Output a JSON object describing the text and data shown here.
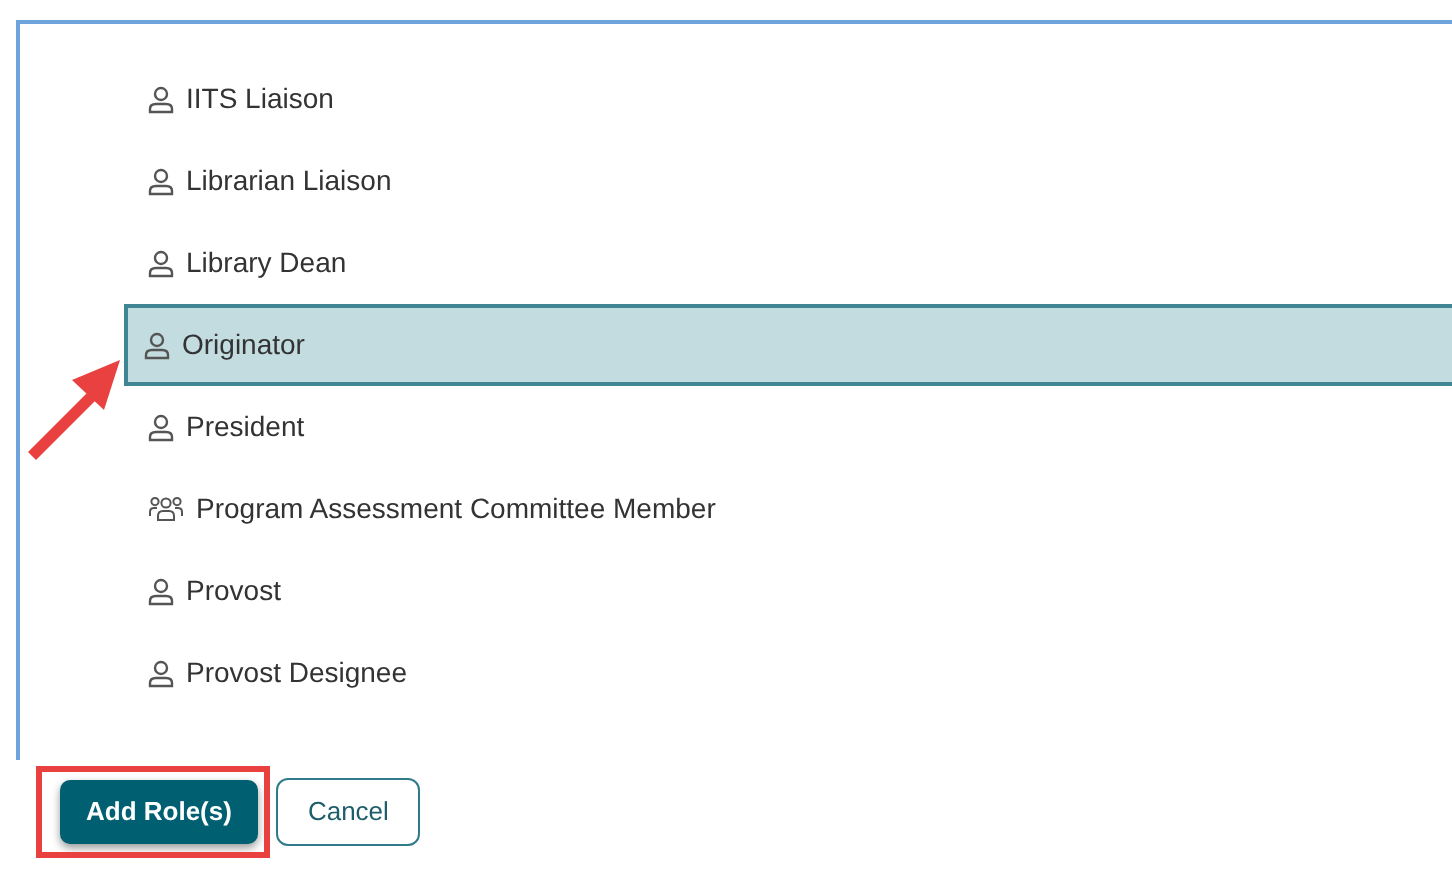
{
  "roles": [
    {
      "label": "IITS Liaison",
      "kind": "person",
      "selected": false
    },
    {
      "label": "Librarian Liaison",
      "kind": "person",
      "selected": false
    },
    {
      "label": "Library Dean",
      "kind": "person",
      "selected": false
    },
    {
      "label": "Originator",
      "kind": "person",
      "selected": true
    },
    {
      "label": "President",
      "kind": "person",
      "selected": false
    },
    {
      "label": "Program Assessment Committee Member",
      "kind": "group",
      "selected": false
    },
    {
      "label": "Provost",
      "kind": "person",
      "selected": false
    },
    {
      "label": "Provost Designee",
      "kind": "person",
      "selected": false
    }
  ],
  "buttons": [
    {
      "label": "Add Role(s)",
      "kind": "primary"
    },
    {
      "label": "Cancel",
      "kind": "secondary"
    }
  ]
}
